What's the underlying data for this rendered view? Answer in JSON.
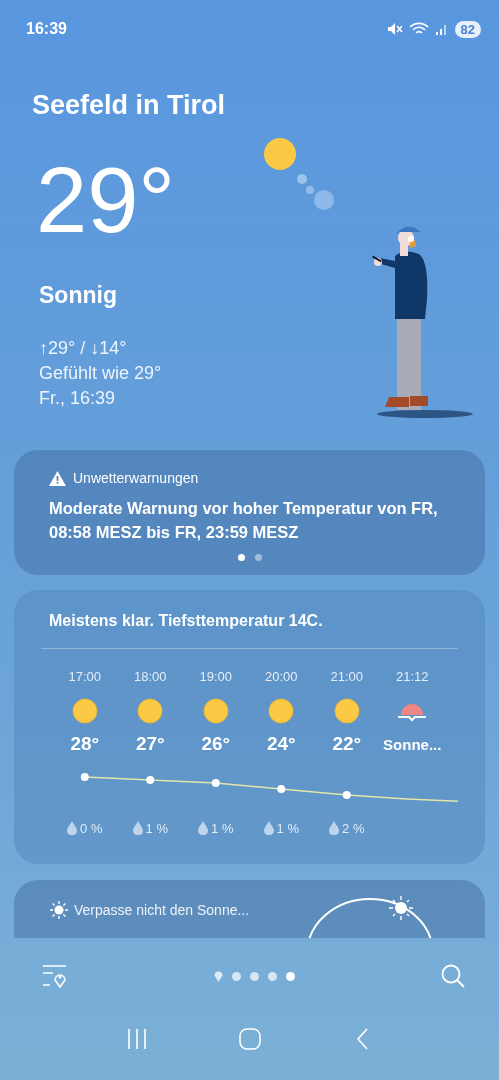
{
  "status_bar": {
    "time": "16:39",
    "battery": "82"
  },
  "location": "Seefeld in Tirol",
  "current": {
    "temperature": "29°",
    "condition": "Sonnig",
    "range": "↑29° / ↓14°",
    "feels_like": "Gefühlt wie 29°",
    "updated": "Fr., 16:39"
  },
  "warning_card": {
    "title": "Unwetterwarnungen",
    "text": "Moderate Warnung vor hoher Temperatur von FR, 08:58 MESZ bis FR, 23:59 MESZ",
    "pages": [
      {
        "selected": true
      },
      {
        "selected": false
      }
    ]
  },
  "hourly_card": {
    "summary": "Meistens klar. Tiefsttemperatur 14C.",
    "hours": [
      {
        "time": "17:00",
        "kind": "sun",
        "temp": "28°",
        "rain": "0 %"
      },
      {
        "time": "18:00",
        "kind": "sun",
        "temp": "27°",
        "rain": "1 %"
      },
      {
        "time": "19:00",
        "kind": "sun",
        "temp": "26°",
        "rain": "1 %"
      },
      {
        "time": "20:00",
        "kind": "sun",
        "temp": "24°",
        "rain": "1 %"
      },
      {
        "time": "21:00",
        "kind": "sun",
        "temp": "22°",
        "rain": "2 %"
      },
      {
        "time": "21:12",
        "kind": "sunset",
        "temp": "Sonne..."
      }
    ]
  },
  "sun_card": {
    "title": "Verpasse nicht den Sonne..."
  },
  "pager": [
    {
      "kind": "location",
      "selected": false
    },
    {
      "kind": "dot",
      "selected": false
    },
    {
      "kind": "dot",
      "selected": false
    },
    {
      "kind": "dot",
      "selected": false
    },
    {
      "kind": "dot",
      "selected": true
    }
  ]
}
